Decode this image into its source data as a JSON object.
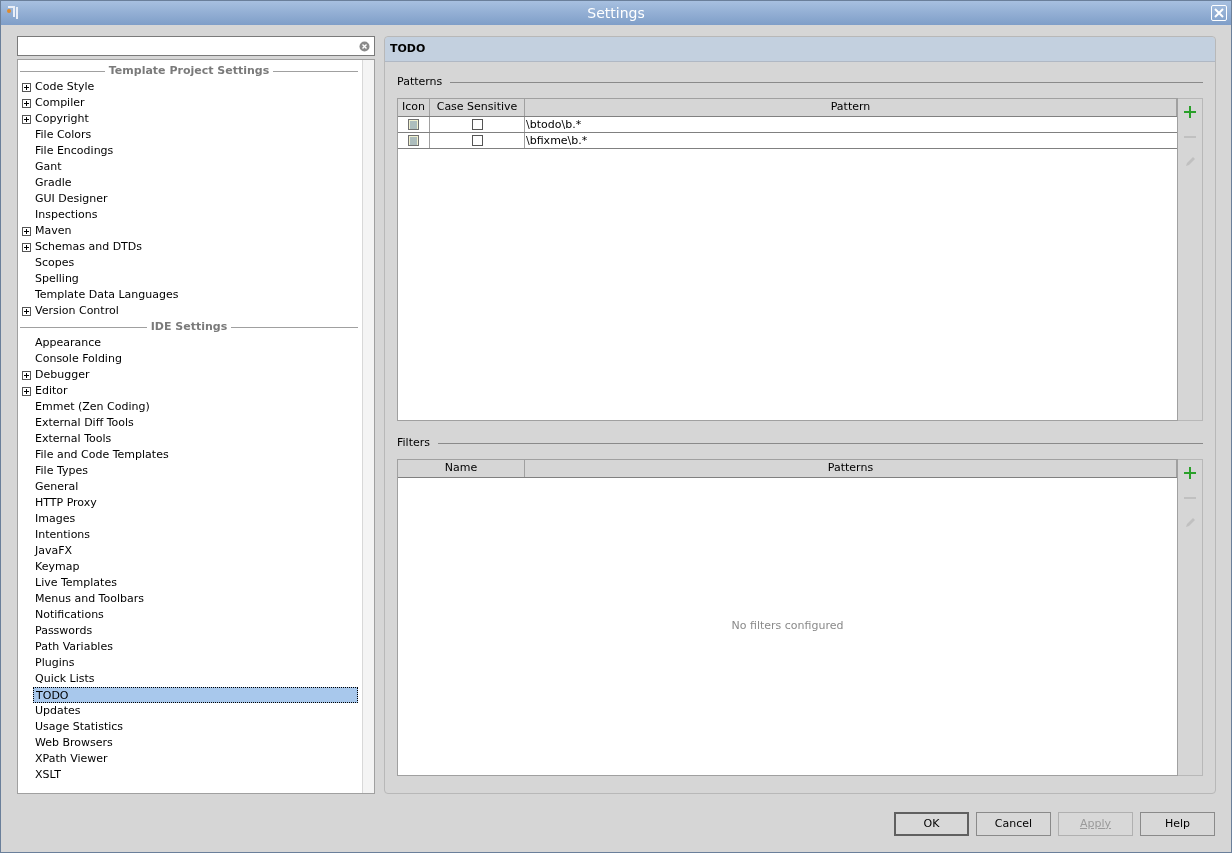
{
  "window": {
    "title": "Settings"
  },
  "sections": [
    {
      "title": "Template Project Settings",
      "items": [
        {
          "label": "Code Style",
          "expandable": true,
          "selected": false
        },
        {
          "label": "Compiler",
          "expandable": true,
          "selected": false
        },
        {
          "label": "Copyright",
          "expandable": true,
          "selected": false
        },
        {
          "label": "File Colors",
          "expandable": false,
          "selected": false
        },
        {
          "label": "File Encodings",
          "expandable": false,
          "selected": false
        },
        {
          "label": "Gant",
          "expandable": false,
          "selected": false
        },
        {
          "label": "Gradle",
          "expandable": false,
          "selected": false
        },
        {
          "label": "GUI Designer",
          "expandable": false,
          "selected": false
        },
        {
          "label": "Inspections",
          "expandable": false,
          "selected": false
        },
        {
          "label": "Maven",
          "expandable": true,
          "selected": false
        },
        {
          "label": "Schemas and DTDs",
          "expandable": true,
          "selected": false
        },
        {
          "label": "Scopes",
          "expandable": false,
          "selected": false
        },
        {
          "label": "Spelling",
          "expandable": false,
          "selected": false
        },
        {
          "label": "Template Data Languages",
          "expandable": false,
          "selected": false
        },
        {
          "label": "Version Control",
          "expandable": true,
          "selected": false
        }
      ]
    },
    {
      "title": "IDE Settings",
      "items": [
        {
          "label": "Appearance",
          "expandable": false,
          "selected": false
        },
        {
          "label": "Console Folding",
          "expandable": false,
          "selected": false
        },
        {
          "label": "Debugger",
          "expandable": true,
          "selected": false
        },
        {
          "label": "Editor",
          "expandable": true,
          "selected": false
        },
        {
          "label": "Emmet (Zen Coding)",
          "expandable": false,
          "selected": false
        },
        {
          "label": "External Diff Tools",
          "expandable": false,
          "selected": false
        },
        {
          "label": "External Tools",
          "expandable": false,
          "selected": false
        },
        {
          "label": "File and Code Templates",
          "expandable": false,
          "selected": false
        },
        {
          "label": "File Types",
          "expandable": false,
          "selected": false
        },
        {
          "label": "General",
          "expandable": false,
          "selected": false
        },
        {
          "label": "HTTP Proxy",
          "expandable": false,
          "selected": false
        },
        {
          "label": "Images",
          "expandable": false,
          "selected": false
        },
        {
          "label": "Intentions",
          "expandable": false,
          "selected": false
        },
        {
          "label": "JavaFX",
          "expandable": false,
          "selected": false
        },
        {
          "label": "Keymap",
          "expandable": false,
          "selected": false
        },
        {
          "label": "Live Templates",
          "expandable": false,
          "selected": false
        },
        {
          "label": "Menus and Toolbars",
          "expandable": false,
          "selected": false
        },
        {
          "label": "Notifications",
          "expandable": false,
          "selected": false
        },
        {
          "label": "Passwords",
          "expandable": false,
          "selected": false
        },
        {
          "label": "Path Variables",
          "expandable": false,
          "selected": false
        },
        {
          "label": "Plugins",
          "expandable": false,
          "selected": false
        },
        {
          "label": "Quick Lists",
          "expandable": false,
          "selected": false
        },
        {
          "label": "TODO",
          "expandable": false,
          "selected": true
        },
        {
          "label": "Updates",
          "expandable": false,
          "selected": false
        },
        {
          "label": "Usage Statistics",
          "expandable": false,
          "selected": false
        },
        {
          "label": "Web Browsers",
          "expandable": false,
          "selected": false
        },
        {
          "label": "XPath Viewer",
          "expandable": false,
          "selected": false
        },
        {
          "label": "XSLT",
          "expandable": false,
          "selected": false
        }
      ]
    }
  ],
  "panel": {
    "title": "TODO",
    "patterns": {
      "title": "Patterns",
      "columns": [
        "Icon",
        "Case Sensitive",
        "Pattern"
      ],
      "rows": [
        {
          "case_sensitive": false,
          "pattern": "\\btodo\\b.*"
        },
        {
          "case_sensitive": false,
          "pattern": "\\bfixme\\b.*"
        }
      ],
      "tools": [
        {
          "kind": "add",
          "disabled": false
        },
        {
          "kind": "remove",
          "disabled": true
        },
        {
          "kind": "edit",
          "disabled": true
        }
      ]
    },
    "filters": {
      "title": "Filters",
      "columns": [
        "Name",
        "Patterns"
      ],
      "empty_text": "No filters configured",
      "tools": [
        {
          "kind": "add",
          "disabled": false
        },
        {
          "kind": "remove",
          "disabled": true
        },
        {
          "kind": "edit",
          "disabled": true
        }
      ]
    }
  },
  "buttons": [
    {
      "label": "OK",
      "disabled": false,
      "default": true
    },
    {
      "label": "Cancel",
      "disabled": false,
      "default": false
    },
    {
      "label": "Apply",
      "disabled": true,
      "default": false
    },
    {
      "label": "Help",
      "disabled": false,
      "default": false
    }
  ]
}
